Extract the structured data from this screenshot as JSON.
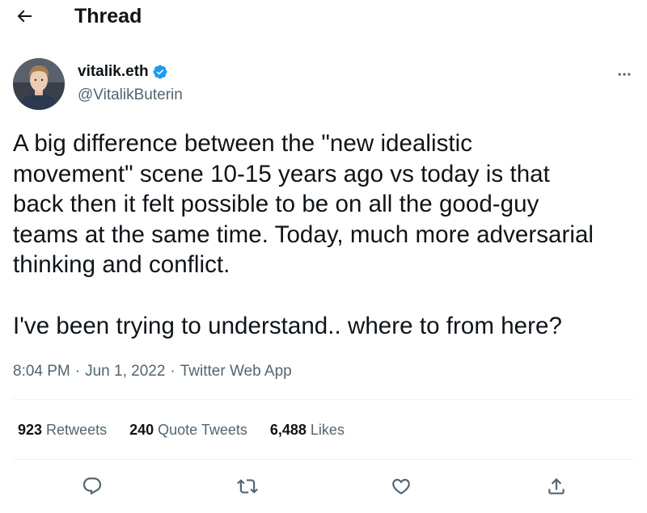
{
  "header": {
    "title": "Thread",
    "back_icon": "arrow-left-icon"
  },
  "author": {
    "display_name": "vitalik.eth",
    "handle": "@VitalikButerin",
    "verified_color": "#1d9bf0"
  },
  "tweet": {
    "text": "A big difference between the \"new idealistic\nmovement\" scene 10-15 years ago vs today is that\nback then it felt possible to be on all the good-guy\nteams at the same time. Today, much more adversarial\nthinking and conflict.\n\nI've been trying to understand.. where to from here?",
    "time": "8:04 PM",
    "date": "Jun 1, 2022",
    "app": "Twitter Web App",
    "separator": "·"
  },
  "stats": {
    "retweets": {
      "count": "923",
      "label": "Retweets"
    },
    "quotes": {
      "count": "240",
      "label": "Quote Tweets"
    },
    "likes": {
      "count": "6,488",
      "label": "Likes"
    }
  },
  "actions": {
    "reply_icon": "reply-icon",
    "retweet_icon": "retweet-icon",
    "like_icon": "heart-icon",
    "share_icon": "share-icon"
  },
  "colors": {
    "text": "#0f1419",
    "secondary": "#536471",
    "divider": "#eff3f4",
    "accent": "#1d9bf0"
  }
}
